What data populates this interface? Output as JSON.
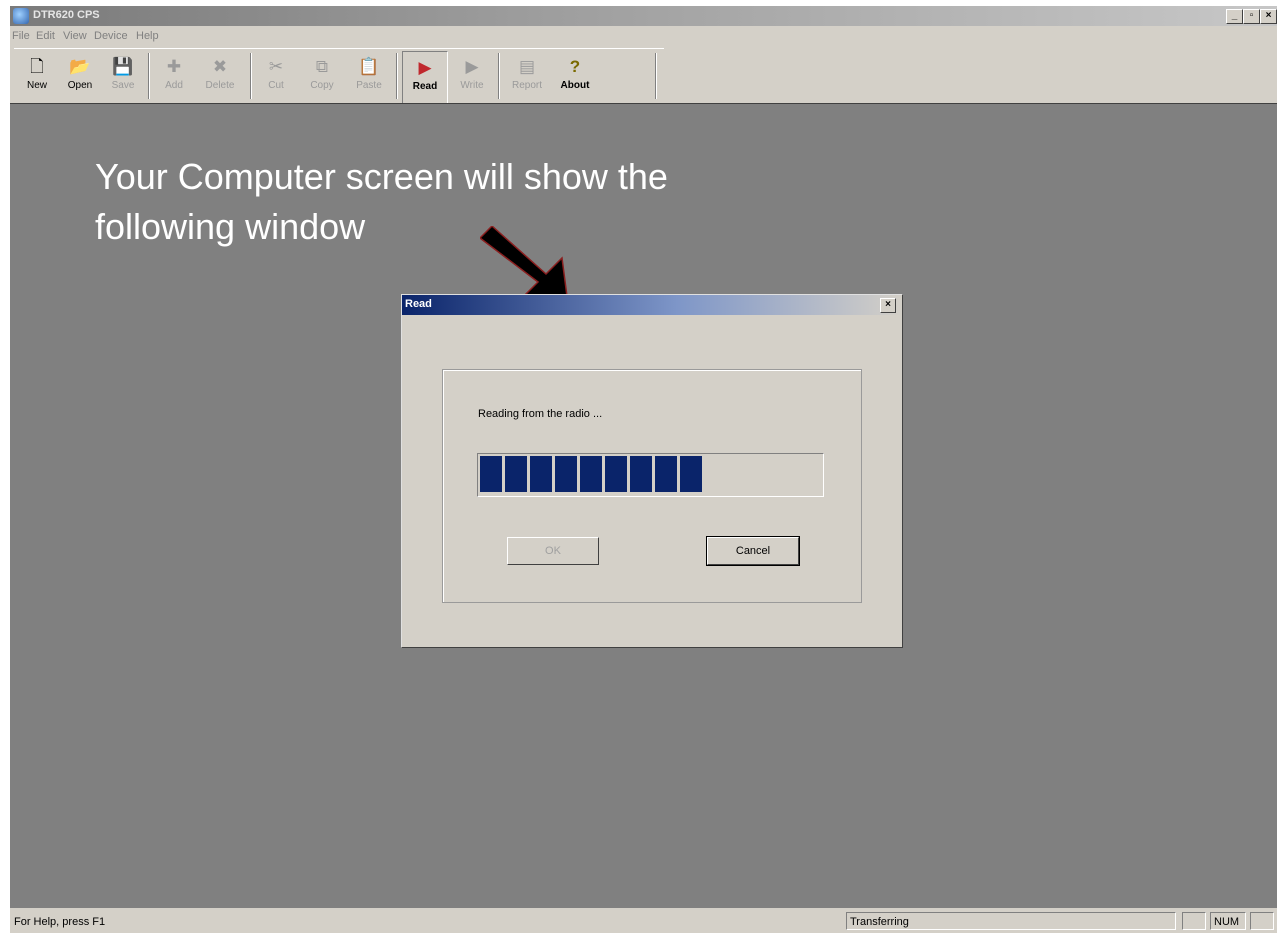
{
  "window": {
    "title": "DTR620 CPS",
    "controls": {
      "minimize": "_",
      "restore": "▫",
      "close": "×"
    }
  },
  "menu": [
    "File",
    "Edit",
    "View",
    "Device",
    "Help"
  ],
  "toolbar": [
    {
      "label": "New",
      "icon": "new-document-icon",
      "glyph": "🗋",
      "enabled": true
    },
    {
      "label": "Open",
      "icon": "open-folder-icon",
      "glyph": "📂",
      "enabled": true
    },
    {
      "label": "Save",
      "icon": "save-disk-icon",
      "glyph": "💾",
      "enabled": false
    },
    {
      "label": "Add",
      "icon": "add-plus-icon",
      "glyph": "✚",
      "enabled": false
    },
    {
      "label": "Delete",
      "icon": "delete-x-icon",
      "glyph": "✖",
      "enabled": false
    },
    {
      "label": "Cut",
      "icon": "scissors-icon",
      "glyph": "✂",
      "enabled": false
    },
    {
      "label": "Copy",
      "icon": "copy-icon",
      "glyph": "⧉",
      "enabled": false
    },
    {
      "label": "Paste",
      "icon": "paste-clipboard-icon",
      "glyph": "📋",
      "enabled": false
    },
    {
      "label": "Read",
      "icon": "read-radio-icon",
      "glyph": "▶",
      "enabled": true,
      "pressed": true
    },
    {
      "label": "Write",
      "icon": "write-radio-icon",
      "glyph": "▶",
      "enabled": false
    },
    {
      "label": "Report",
      "icon": "report-icon",
      "glyph": "▤",
      "enabled": false
    },
    {
      "label": "About",
      "icon": "about-key-icon",
      "glyph": "?",
      "enabled": true
    }
  ],
  "caption": "Your Computer screen will show the following window",
  "dialog": {
    "title": "Read",
    "close": "×",
    "message": "Reading from the radio ...",
    "progress": {
      "filled_chunks": 9,
      "fraction": 0.65
    },
    "ok_label": "OK",
    "cancel_label": "Cancel"
  },
  "statusbar": {
    "help": "For Help, press F1",
    "transfer": "Transferring",
    "num": "NUM"
  },
  "colors": {
    "workspace": "#808080",
    "progress": "#0a246a",
    "dialog_title": "#0a246a"
  }
}
